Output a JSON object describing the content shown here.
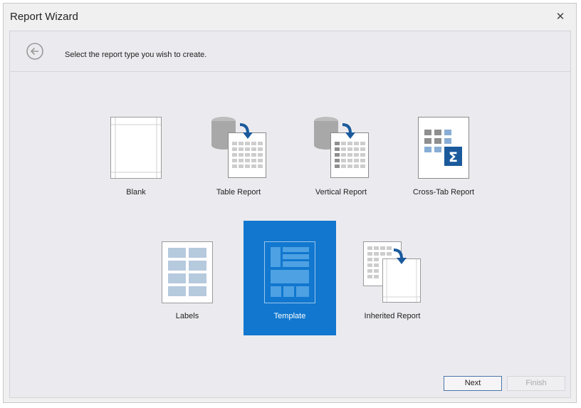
{
  "window": {
    "title": "Report Wizard"
  },
  "header": {
    "instruction": "Select the report type you wish to create."
  },
  "report_types": [
    {
      "label": "Blank",
      "icon": "blank-page-icon",
      "selected": false
    },
    {
      "label": "Table Report",
      "icon": "table-report-icon",
      "selected": false
    },
    {
      "label": "Vertical Report",
      "icon": "vertical-report-icon",
      "selected": false
    },
    {
      "label": "Cross-Tab Report",
      "icon": "cross-tab-report-icon",
      "selected": false
    },
    {
      "label": "Labels",
      "icon": "labels-icon",
      "selected": false
    },
    {
      "label": "Template",
      "icon": "template-icon",
      "selected": true
    },
    {
      "label": "Inherited Report",
      "icon": "inherited-report-icon",
      "selected": false
    }
  ],
  "footer": {
    "next_label": "Next",
    "finish_label": "Finish",
    "finish_enabled": false
  },
  "colors": {
    "accent": "#1177cf",
    "icon_blue": "#1a5a9c",
    "grid_gray": "#a0a0a0"
  }
}
